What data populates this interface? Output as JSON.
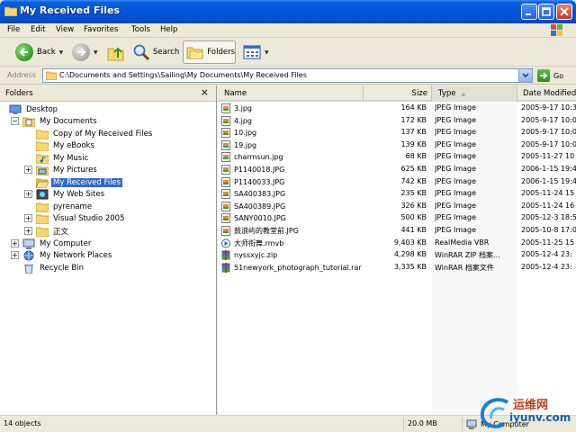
{
  "window": {
    "title": "My Received Files"
  },
  "menu": [
    "File",
    "Edit",
    "View",
    "Favorites",
    "Tools",
    "Help"
  ],
  "toolbar": {
    "back": "Back",
    "search": "Search",
    "folders": "Folders"
  },
  "address": {
    "label": "Address",
    "value": "C:\\Documents and Settings\\Sailing\\My Documents\\My Received Files",
    "go": "Go"
  },
  "folders_pane": {
    "title": "Folders",
    "close": "×",
    "tree": [
      {
        "label": "Desktop",
        "icon": "desktop-icon",
        "expander": ""
      },
      {
        "label": "My Documents",
        "icon": "my-documents-icon",
        "expander": "−"
      },
      {
        "label": "Copy of My Received Files",
        "icon": "folder-icon",
        "expander": ""
      },
      {
        "label": "My eBooks",
        "icon": "folder-icon",
        "expander": ""
      },
      {
        "label": "My Music",
        "icon": "music-folder-icon",
        "expander": ""
      },
      {
        "label": "My Pictures",
        "icon": "pictures-folder-icon",
        "expander": "+"
      },
      {
        "label": "My Received Files",
        "icon": "folder-open-icon",
        "expander": "",
        "selected": true
      },
      {
        "label": "My Web Sites",
        "icon": "web-folder-icon",
        "expander": "+"
      },
      {
        "label": "pyrename",
        "icon": "folder-icon",
        "expander": ""
      },
      {
        "label": "Visual Studio 2005",
        "icon": "folder-icon",
        "expander": "+"
      },
      {
        "label": "正文",
        "icon": "folder-icon",
        "expander": "+"
      },
      {
        "label": "My Computer",
        "icon": "computer-icon",
        "expander": "+"
      },
      {
        "label": "My Network Places",
        "icon": "network-icon",
        "expander": "+"
      },
      {
        "label": "Recycle Bin",
        "icon": "recycle-bin-icon",
        "expander": ""
      }
    ]
  },
  "columns": {
    "name": "Name",
    "size": "Size",
    "type": "Type",
    "date": "Date Modified"
  },
  "files": [
    {
      "name": "3.jpg",
      "size": "164 KB",
      "type": "JPEG Image",
      "date": "2005-9-17 10:3",
      "icon": "jpeg-file-icon"
    },
    {
      "name": "4.jpg",
      "size": "172 KB",
      "type": "JPEG Image",
      "date": "2005-9-17 10:0",
      "icon": "jpeg-file-icon"
    },
    {
      "name": "10.jpg",
      "size": "137 KB",
      "type": "JPEG Image",
      "date": "2005-9-17 10:0",
      "icon": "jpeg-file-icon"
    },
    {
      "name": "19.jpg",
      "size": "139 KB",
      "type": "JPEG Image",
      "date": "2005-9-17 10:0",
      "icon": "jpeg-file-icon"
    },
    {
      "name": "charmsun.jpg",
      "size": "68 KB",
      "type": "JPEG Image",
      "date": "2005-11-27 10",
      "icon": "jpeg-file-icon"
    },
    {
      "name": "P1140018.JPG",
      "size": "625 KB",
      "type": "JPEG Image",
      "date": "2006-1-15 19:4",
      "icon": "jpeg-file-icon"
    },
    {
      "name": "P1140033.JPG",
      "size": "742 KB",
      "type": "JPEG Image",
      "date": "2006-1-15 19:4",
      "icon": "jpeg-file-icon"
    },
    {
      "name": "SA400383.JPG",
      "size": "235 KB",
      "type": "JPEG Image",
      "date": "2005-11-24 15",
      "icon": "jpeg-file-icon"
    },
    {
      "name": "SA400389.JPG",
      "size": "326 KB",
      "type": "JPEG Image",
      "date": "2005-11-24 16",
      "icon": "jpeg-file-icon"
    },
    {
      "name": "SANY0010.JPG",
      "size": "500 KB",
      "type": "JPEG Image",
      "date": "2005-12-3 18:5",
      "icon": "jpeg-file-icon"
    },
    {
      "name": "鼓浪屿的教堂前.JPG",
      "size": "441 KB",
      "type": "JPEG Image",
      "date": "2005-10-8 17:0",
      "icon": "jpeg-file-icon"
    },
    {
      "name": "大师衔舞.rmvb",
      "size": "9,403 KB",
      "type": "RealMedia VBR",
      "date": "2005-11-25 15",
      "icon": "realmedia-file-icon"
    },
    {
      "name": "nyssxyjc.zip",
      "size": "4,298 KB",
      "type": "WinRAR ZIP 档案...",
      "date": "2005-12-4 23:",
      "icon": "winrar-archive-icon"
    },
    {
      "name": "51newyork_photograph_tutorial.rar",
      "size": "3,335 KB",
      "type": "WinRAR 档案文件",
      "date": "2005-12-4 23:",
      "icon": "winrar-archive-icon"
    }
  ],
  "status": {
    "objects": "14 objects",
    "size": "20.0 MB",
    "location": "My Computer"
  },
  "watermark": {
    "line1": "运维网",
    "line2": "iyunv.com"
  }
}
